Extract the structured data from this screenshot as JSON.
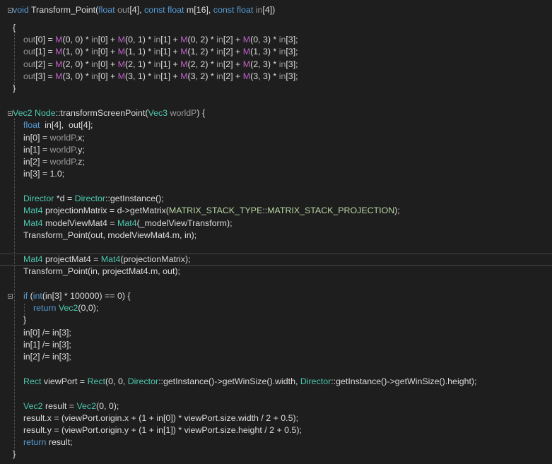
{
  "editor": {
    "colors": {
      "background": "#1e1e1e",
      "keyword": "#569cd6",
      "type": "#4ec9b0",
      "macro": "#bd63c5",
      "parameter": "#9a9a9a",
      "enum": "#b8d7a3",
      "text": "#dcdcdc"
    },
    "lines": [
      [
        [
          "kw",
          "void"
        ],
        [
          "txt",
          " Transform_Point("
        ],
        [
          "kw",
          "float"
        ],
        [
          "par",
          " out"
        ],
        [
          "txt",
          "[4], "
        ],
        [
          "kw",
          "const float"
        ],
        [
          "txt",
          " m[16], "
        ],
        [
          "kw",
          "const float"
        ],
        [
          "par",
          " in"
        ],
        [
          "txt",
          "[4])"
        ]
      ],
      [
        [
          "txt",
          "{"
        ]
      ],
      [
        [
          "par",
          "out"
        ],
        [
          "txt",
          "[0] = "
        ],
        [
          "mac",
          "M"
        ],
        [
          "txt",
          "(0, 0) * "
        ],
        [
          "par",
          "in"
        ],
        [
          "txt",
          "[0] + "
        ],
        [
          "mac",
          "M"
        ],
        [
          "txt",
          "(0, 1) * "
        ],
        [
          "par",
          "in"
        ],
        [
          "txt",
          "[1] + "
        ],
        [
          "mac",
          "M"
        ],
        [
          "txt",
          "(0, 2) * "
        ],
        [
          "par",
          "in"
        ],
        [
          "txt",
          "[2] + "
        ],
        [
          "mac",
          "M"
        ],
        [
          "txt",
          "(0, 3) * "
        ],
        [
          "par",
          "in"
        ],
        [
          "txt",
          "[3];"
        ]
      ],
      [
        [
          "par",
          "out"
        ],
        [
          "txt",
          "[1] = "
        ],
        [
          "mac",
          "M"
        ],
        [
          "txt",
          "(1, 0) * "
        ],
        [
          "par",
          "in"
        ],
        [
          "txt",
          "[0] + "
        ],
        [
          "mac",
          "M"
        ],
        [
          "txt",
          "(1, 1) * "
        ],
        [
          "par",
          "in"
        ],
        [
          "txt",
          "[1] + "
        ],
        [
          "mac",
          "M"
        ],
        [
          "txt",
          "(1, 2) * "
        ],
        [
          "par",
          "in"
        ],
        [
          "txt",
          "[2] + "
        ],
        [
          "mac",
          "M"
        ],
        [
          "txt",
          "(1, 3) * "
        ],
        [
          "par",
          "in"
        ],
        [
          "txt",
          "[3];"
        ]
      ],
      [
        [
          "par",
          "out"
        ],
        [
          "txt",
          "[2] = "
        ],
        [
          "mac",
          "M"
        ],
        [
          "txt",
          "(2, 0) * "
        ],
        [
          "par",
          "in"
        ],
        [
          "txt",
          "[0] + "
        ],
        [
          "mac",
          "M"
        ],
        [
          "txt",
          "(2, 1) * "
        ],
        [
          "par",
          "in"
        ],
        [
          "txt",
          "[1] + "
        ],
        [
          "mac",
          "M"
        ],
        [
          "txt",
          "(2, 2) * "
        ],
        [
          "par",
          "in"
        ],
        [
          "txt",
          "[2] + "
        ],
        [
          "mac",
          "M"
        ],
        [
          "txt",
          "(2, 3) * "
        ],
        [
          "par",
          "in"
        ],
        [
          "txt",
          "[3];"
        ]
      ],
      [
        [
          "par",
          "out"
        ],
        [
          "txt",
          "[3] = "
        ],
        [
          "mac",
          "M"
        ],
        [
          "txt",
          "(3, 0) * "
        ],
        [
          "par",
          "in"
        ],
        [
          "txt",
          "[0] + "
        ],
        [
          "mac",
          "M"
        ],
        [
          "txt",
          "(3, 1) * "
        ],
        [
          "par",
          "in"
        ],
        [
          "txt",
          "[1] + "
        ],
        [
          "mac",
          "M"
        ],
        [
          "txt",
          "(3, 2) * "
        ],
        [
          "par",
          "in"
        ],
        [
          "txt",
          "[2] + "
        ],
        [
          "mac",
          "M"
        ],
        [
          "txt",
          "(3, 3) * "
        ],
        [
          "par",
          "in"
        ],
        [
          "txt",
          "[3];"
        ]
      ],
      [
        [
          "txt",
          "}"
        ]
      ],
      [],
      [
        [
          "ty",
          "Vec2"
        ],
        [
          "txt",
          " "
        ],
        [
          "ty",
          "Node"
        ],
        [
          "txt",
          "::transformScreenPoint("
        ],
        [
          "ty",
          "Vec3"
        ],
        [
          "par",
          " worldP"
        ],
        [
          "txt",
          ") {"
        ]
      ],
      [
        [
          "kw",
          "float"
        ],
        [
          "txt",
          "  in[4],  out[4];"
        ]
      ],
      [
        [
          "txt",
          "in[0] = "
        ],
        [
          "par",
          "worldP"
        ],
        [
          "txt",
          ".x;"
        ]
      ],
      [
        [
          "txt",
          "in[1] = "
        ],
        [
          "par",
          "worldP"
        ],
        [
          "txt",
          ".y;"
        ]
      ],
      [
        [
          "txt",
          "in[2] = "
        ],
        [
          "par",
          "worldP"
        ],
        [
          "txt",
          ".z;"
        ]
      ],
      [
        [
          "txt",
          "in[3] = 1.0;"
        ]
      ],
      [],
      [
        [
          "ty",
          "Director"
        ],
        [
          "txt",
          " *d = "
        ],
        [
          "ty",
          "Director"
        ],
        [
          "txt",
          "::getInstance();"
        ]
      ],
      [
        [
          "ty",
          "Mat4"
        ],
        [
          "txt",
          " projectionMatrix = d->getMatrix("
        ],
        [
          "en",
          "MATRIX_STACK_TYPE"
        ],
        [
          "txt",
          "::"
        ],
        [
          "en",
          "MATRIX_STACK_PROJECTION"
        ],
        [
          "txt",
          ");"
        ]
      ],
      [
        [
          "ty",
          "Mat4"
        ],
        [
          "txt",
          " modelViewMat4 = "
        ],
        [
          "ty",
          "Mat4"
        ],
        [
          "txt",
          "(_modelViewTransform);"
        ]
      ],
      [
        [
          "txt",
          "Transform_Point(out, modelViewMat4.m, in);"
        ]
      ],
      [],
      [
        [
          "ty",
          "Mat4"
        ],
        [
          "txt",
          " projectMat4 = "
        ],
        [
          "ty",
          "Mat4"
        ],
        [
          "txt",
          "(projectionMatrix);"
        ]
      ],
      [
        [
          "txt",
          "Transform_Point(in, projectMat4.m, out);"
        ]
      ],
      [],
      [
        [
          "kw",
          "if"
        ],
        [
          "txt",
          " ("
        ],
        [
          "kw",
          "int"
        ],
        [
          "txt",
          "(in[3] * 100000) == 0) {"
        ]
      ],
      [
        [
          "kw",
          "return"
        ],
        [
          "txt",
          " "
        ],
        [
          "ty",
          "Vec2"
        ],
        [
          "txt",
          "(0,0);"
        ]
      ],
      [
        [
          "txt",
          "}"
        ]
      ],
      [
        [
          "txt",
          "in[0] /= in[3];"
        ]
      ],
      [
        [
          "txt",
          "in[1] /= in[3];"
        ]
      ],
      [
        [
          "txt",
          "in[2] /= in[3];"
        ]
      ],
      [],
      [
        [
          "ty",
          "Rect"
        ],
        [
          "txt",
          " viewPort = "
        ],
        [
          "ty",
          "Rect"
        ],
        [
          "txt",
          "(0, 0, "
        ],
        [
          "ty",
          "Director"
        ],
        [
          "txt",
          "::getInstance()->getWinSize().width, "
        ],
        [
          "ty",
          "Director"
        ],
        [
          "txt",
          "::getInstance()->getWinSize().height);"
        ]
      ],
      [],
      [
        [
          "ty",
          "Vec2"
        ],
        [
          "txt",
          " result = "
        ],
        [
          "ty",
          "Vec2"
        ],
        [
          "txt",
          "(0, 0);"
        ]
      ],
      [
        [
          "txt",
          "result.x = (viewPort.origin.x + (1 + in[0]) * viewPort.size.width / 2 + 0.5);"
        ]
      ],
      [
        [
          "txt",
          "result.y = (viewPort.origin.y + (1 + in[1]) * viewPort.size.height / 2 + 0.5);"
        ]
      ],
      [
        [
          "kw",
          "return"
        ],
        [
          "txt",
          " result;"
        ]
      ],
      [
        [
          "txt",
          "}"
        ]
      ]
    ]
  }
}
